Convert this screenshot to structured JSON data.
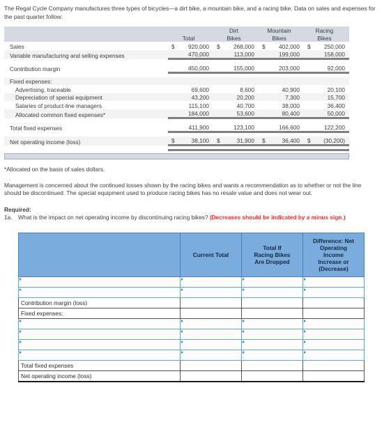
{
  "intro": "The Regal Cycle Company manufactures three types of bicycles—a dirt bike, a mountain bike, and a racing bike. Data on sales and expenses for the past quarter follow:",
  "data_table": {
    "columns": [
      "Total",
      "Dirt Bikes",
      "Mountain Bikes",
      "Racing Bikes"
    ],
    "headers_line1": [
      "",
      "Dirt",
      "Mountain",
      "Racing"
    ],
    "headers_line2": [
      "Total",
      "Bikes",
      "Bikes",
      "Bikes"
    ],
    "rows": [
      {
        "label": "Sales",
        "indent": false,
        "values": [
          "920,000",
          "268,000",
          "402,000",
          "250,000"
        ],
        "currency": true
      },
      {
        "label": "Variable manufacturing and selling expenses",
        "indent": false,
        "values": [
          "470,000",
          "113,000",
          "199,000",
          "158,000"
        ],
        "currency": false
      },
      {
        "label": "Contribution margin",
        "indent": false,
        "values": [
          "450,000",
          "155,000",
          "203,000",
          "92,000"
        ],
        "currency": false
      },
      {
        "label": "Fixed expenses:",
        "indent": false,
        "values": [
          "",
          "",
          "",
          ""
        ],
        "currency": false
      },
      {
        "label": "Advertising, traceable",
        "indent": true,
        "values": [
          "69,600",
          "8,600",
          "40,900",
          "20,100"
        ],
        "currency": false
      },
      {
        "label": "Depreciation of special equipment",
        "indent": true,
        "values": [
          "43,200",
          "20,200",
          "7,300",
          "15,700"
        ],
        "currency": false
      },
      {
        "label": "Salaries of product-line managers",
        "indent": true,
        "values": [
          "115,100",
          "40,700",
          "38,000",
          "36,400"
        ],
        "currency": false
      },
      {
        "label": "Allocated common fixed expenses*",
        "indent": true,
        "values": [
          "184,000",
          "53,600",
          "80,400",
          "50,000"
        ],
        "currency": false
      },
      {
        "label": "Total fixed expenses",
        "indent": false,
        "values": [
          "411,900",
          "123,100",
          "166,600",
          "122,200"
        ],
        "currency": false
      },
      {
        "label": "Net operating income (loss)",
        "indent": false,
        "values": [
          "38,100",
          "31,900",
          "36,400",
          "(30,200)"
        ],
        "currency": true
      }
    ]
  },
  "footnote": "*Allocated on the basis of sales dollars.",
  "paragraph": "Management is concerned about the continued losses shown by the racing bikes and wants a recommendation as to whether or not the line should be discontinued. The special equipment used to produce racing bikes has no resale value and does not wear out.",
  "required": {
    "heading": "Required:",
    "item_index": "1a.",
    "item_text": "What is the impact on net operating income by discontinuing racing bikes?",
    "item_note": "(Decreases should be indicated by a minus sign.)"
  },
  "answer_table": {
    "headers": [
      "",
      "Current Total",
      "Total If Racing Bikes Are Dropped",
      "Difference: Net Operating Income Increase or (Decrease)"
    ],
    "header_lines": {
      "col1": [
        "Current Total"
      ],
      "col2": [
        "Total If",
        "Racing Bikes",
        "Are Dropped"
      ],
      "col3": [
        "Difference: Net",
        "Operating",
        "Income",
        "Increase or",
        "(Decrease)"
      ]
    },
    "rows": [
      {
        "label": "",
        "editable": true,
        "values": [
          "",
          "",
          ""
        ]
      },
      {
        "label": "",
        "editable": true,
        "values": [
          "",
          "",
          ""
        ]
      },
      {
        "label": "Contribution margin (loss)",
        "editable": false,
        "values": [
          "",
          "",
          ""
        ]
      },
      {
        "label": "Fixed expenses:",
        "editable": false,
        "values": [
          "",
          "",
          ""
        ]
      },
      {
        "label": "",
        "editable": true,
        "values": [
          "",
          "",
          ""
        ]
      },
      {
        "label": "",
        "editable": true,
        "values": [
          "",
          "",
          ""
        ]
      },
      {
        "label": "",
        "editable": true,
        "values": [
          "",
          "",
          ""
        ]
      },
      {
        "label": "",
        "editable": true,
        "values": [
          "",
          "",
          ""
        ]
      },
      {
        "label": "Total fixed expenses",
        "editable": false,
        "values": [
          "",
          "",
          ""
        ]
      },
      {
        "label": "Net operating income (loss)",
        "editable": false,
        "values": [
          "",
          "",
          ""
        ]
      }
    ]
  },
  "colors": {
    "header_blue": "#7aadde",
    "header_gray": "#d4d9e2",
    "rule_gray": "#808080",
    "red": "#ff2a2a",
    "text": "#3c3c3c"
  }
}
